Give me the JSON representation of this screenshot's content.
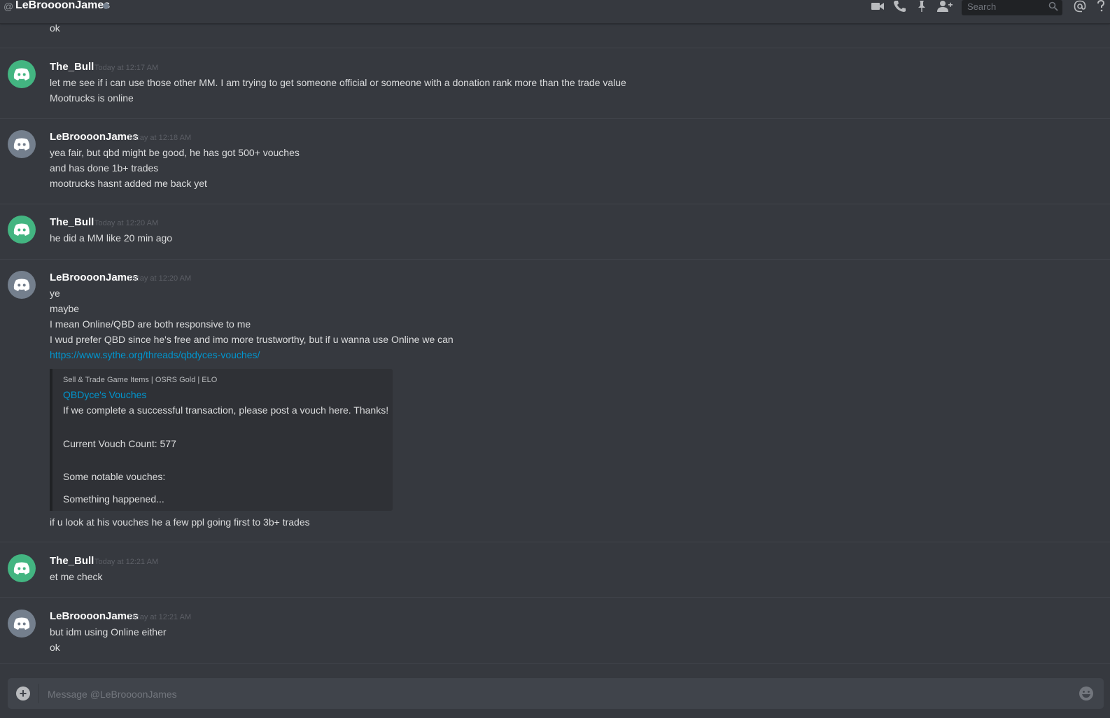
{
  "header": {
    "at_symbol": "@",
    "title": "LeBroooonJames",
    "search_placeholder": "Search",
    "icons": [
      "video-call-icon",
      "voice-call-icon",
      "pin-icon",
      "add-friend-icon",
      "search-icon",
      "mention-icon",
      "help-icon"
    ]
  },
  "messages": {
    "top_fragment": "ok",
    "g1": {
      "author": "The_Bull",
      "timestamp": "Today at 12:17 AM",
      "lines": [
        "let me see if i can use those other MM. I am trying to get someone official or someone with a donation rank more than the trade value",
        "Mootrucks is online"
      ]
    },
    "g2": {
      "author": "LeBroooonJames",
      "timestamp": "Today at 12:18 AM",
      "lines": [
        "yea fair, but qbd might be good, he has got 500+ vouches",
        "and has done 1b+ trades",
        "mootrucks hasnt added me back yet"
      ]
    },
    "g3": {
      "author": "The_Bull",
      "timestamp": "Today at 12:20 AM",
      "lines": [
        "he did a MM like 20 min ago"
      ]
    },
    "g4": {
      "author": "LeBroooonJames",
      "timestamp": "Today at 12:20 AM",
      "lines": [
        "ye",
        "maybe",
        "I mean Online/QBD are both responsive to me",
        "I wud prefer QBD since he's free and imo more trustworthy, but if u wanna use Online we can"
      ],
      "link": "https://www.sythe.org/threads/qbdyces-vouches/",
      "embed": {
        "provider": "Sell & Trade Game Items | OSRS Gold | ELO",
        "title": "QBDyce's Vouches",
        "desc1": "If we complete a successful transaction, please post a vouch here. Thanks!",
        "desc2": "Current Vouch Count: 577",
        "desc3": "Some notable vouches:",
        "desc4": "Something happened..."
      },
      "after": "if u look at his vouches he a few ppl going first to 3b+ trades"
    },
    "g5": {
      "author": "The_Bull",
      "timestamp": "Today at 12:21 AM",
      "lines": [
        "et me check"
      ]
    },
    "g6": {
      "author": "LeBroooonJames",
      "timestamp": "Today at 12:21 AM",
      "lines": [
        "but idm using Online either",
        "ok"
      ]
    }
  },
  "composer": {
    "placeholder": "Message @LeBroooonJames"
  },
  "colors": {
    "background": "#36393f",
    "avatar_green": "#43b581",
    "avatar_grey": "#747f8d",
    "link": "#0096cf"
  }
}
